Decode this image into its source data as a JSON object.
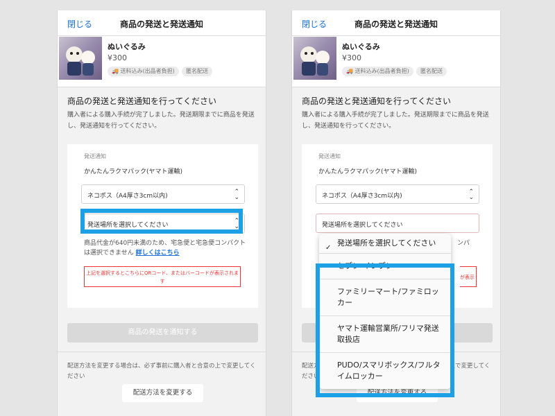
{
  "left_screen": {
    "header": {
      "close_label": "閉じる",
      "title": "商品の発送と発送通知"
    },
    "product": {
      "name": "ぬいぐるみ",
      "price": "¥300",
      "tags": [
        "🚚 送料込み(出品者負担)",
        "匿名配送"
      ]
    },
    "section_title": "商品の発送と発送通知を行ってください",
    "section_desc": "購入者による購入手続が完了しました。発送期限までに商品を発送し、発送通知を行ってください。",
    "card": {
      "label": "発送通知",
      "method": "かんたんラクマパック(ヤマト運輸)",
      "size_select_value": "ネコポス（A4厚さ3cm以内)",
      "place_select_value": "発送場所を選択してください",
      "note_text": "商品代金が640円未満のため、宅急便と宅急便コンパクトは選択できません",
      "note_link": "詳しくはこちら",
      "qr_note": "上記を選択するとこちらにQRコード、またはバーコードが表示されます"
    },
    "notify_button_label": "商品の発送を通知する",
    "change_note": "配送方法を変更する場合は、必ず事前に購入者と合意の上で変更してください",
    "change_button_label": "配送方法を変更する"
  },
  "right_screen": {
    "header": {
      "close_label": "閉じる",
      "title": "商品の発送と発送通知"
    },
    "product": {
      "name": "ぬいぐるみ",
      "price": "¥300",
      "tags": [
        "🚚 送料込み(出品者負担)",
        "匿名配送"
      ]
    },
    "section_title": "商品の発送と発送通知を行ってください",
    "section_desc": "購入者による購入手続が完了しました。発送期限までに商品を発送し、発送通知を行ってください。",
    "card": {
      "label": "発送通知",
      "method": "かんたんラクマパック(ヤマト運輸)",
      "size_select_value": "ネコポス（A4厚さ3cm以内)",
      "place_select_value": "発送場所を選択してください",
      "note_tail": "ンパ",
      "qr_note_tail": "が表示"
    },
    "notify_button_label": "商品の発送を通知する",
    "change_note": "配送方法を変更する場合は、必ず事前に購入者と合意の上で変更してください",
    "change_button_label": "配送方法を変更する"
  },
  "dropdown": {
    "selected": "発送場所を選択してください",
    "options": [
      "セブン-イレブン",
      "ファミリーマート/ファミロッカー",
      "ヤマト運輸営業所/フリマ発送取扱店",
      "PUDO/スマリボックス/フルタイムロッカー"
    ]
  },
  "highlight_color": "#1ea0e6",
  "accent_color": "#1a6fd8"
}
